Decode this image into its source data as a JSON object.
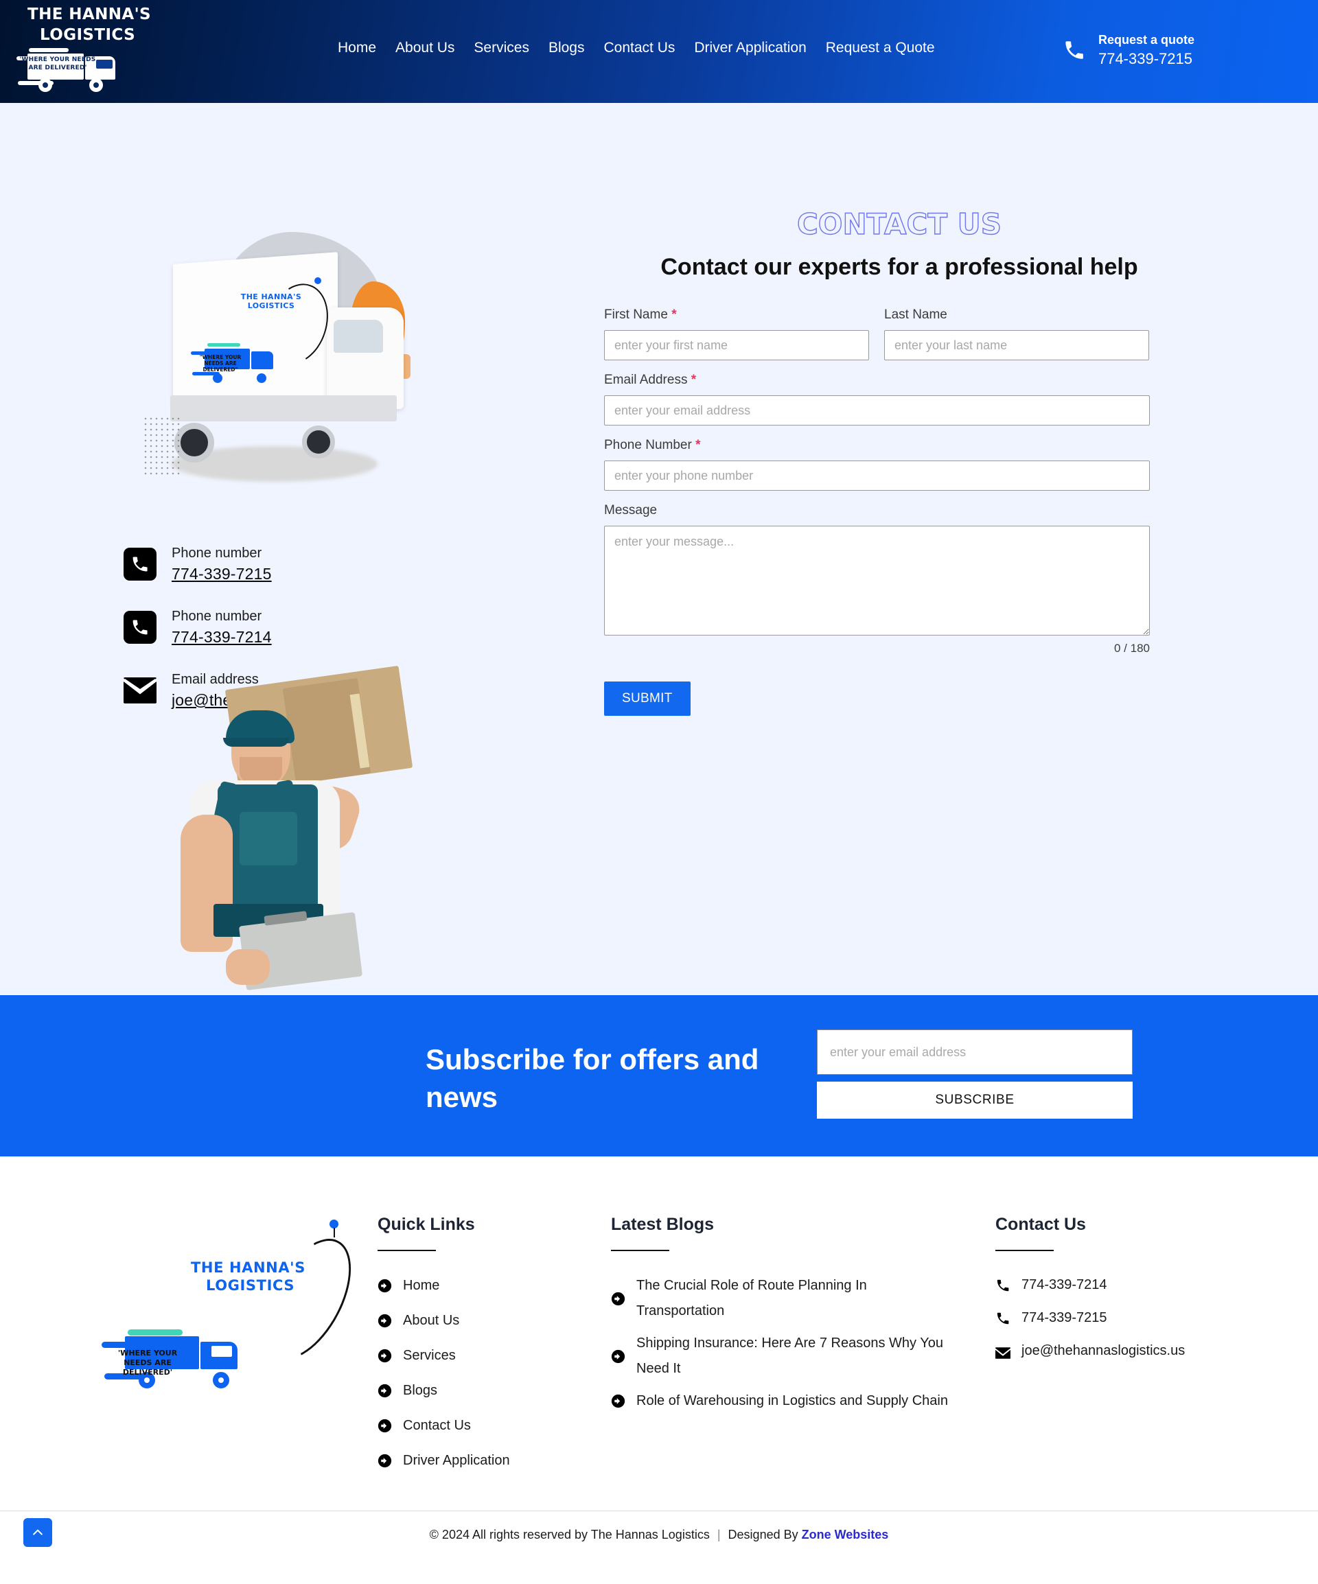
{
  "header": {
    "logo": {
      "line1": "THE HANNA'S",
      "line2": "LOGISTICS",
      "tagline": "'WHERE YOUR NEEDS ARE DELIVERED'"
    },
    "nav": [
      {
        "label": "Home"
      },
      {
        "label": "About Us"
      },
      {
        "label": "Services"
      },
      {
        "label": "Blogs"
      },
      {
        "label": "Contact Us"
      },
      {
        "label": "Driver Application"
      },
      {
        "label": "Request a Quote"
      }
    ],
    "quote": {
      "label": "Request a quote",
      "phone": "774-339-7215"
    }
  },
  "contact": {
    "kicker": "CONTACT US",
    "title": "Contact our experts for a professional help",
    "truck_logo": {
      "line1": "THE HANNA'S",
      "line2": "LOGISTICS",
      "tagline": "\"WHERE YOUR NEEDS ARE DELIVERED\""
    },
    "details": [
      {
        "icon": "phone-icon",
        "label": "Phone number",
        "value": "774-339-7215"
      },
      {
        "icon": "phone-icon",
        "label": "Phone number",
        "value": "774-339-7214"
      },
      {
        "icon": "mail-icon",
        "label": "Email address",
        "value": "joe@thehannaslogistics.us"
      }
    ],
    "form": {
      "first_name": {
        "label": "First Name",
        "required": "*",
        "placeholder": "enter your first name",
        "value": ""
      },
      "last_name": {
        "label": "Last Name",
        "required": "",
        "placeholder": "enter your last name",
        "value": ""
      },
      "email": {
        "label": "Email Address",
        "required": "*",
        "placeholder": "enter your email address",
        "value": ""
      },
      "phone": {
        "label": "Phone Number",
        "required": "*",
        "placeholder": "enter your phone number",
        "value": ""
      },
      "message": {
        "label": "Message",
        "required": "",
        "placeholder": "enter your message...",
        "value": ""
      },
      "counter": "0 / 180",
      "submit_label": "SUBMIT"
    }
  },
  "subscribe": {
    "title": "Subscribe for offers and news",
    "email_placeholder": "enter your email address",
    "email_value": "",
    "button_label": "SUBSCRIBE"
  },
  "footer": {
    "logo": {
      "line1": "THE HANNA'S",
      "line2": "LOGISTICS",
      "tagline": "'WHERE YOUR NEEDS ARE DELIVERED'"
    },
    "quick_links": {
      "heading": "Quick Links",
      "items": [
        {
          "label": "Home"
        },
        {
          "label": "About Us"
        },
        {
          "label": "Services"
        },
        {
          "label": "Blogs"
        },
        {
          "label": "Contact Us"
        },
        {
          "label": "Driver Application"
        }
      ]
    },
    "latest_blogs": {
      "heading": "Latest Blogs",
      "items": [
        {
          "label": "The Crucial Role of Route Planning In Transportation"
        },
        {
          "label": "Shipping Insurance: Here Are 7 Reasons Why You Need It"
        },
        {
          "label": "Role of Warehousing in Logistics and Supply Chain"
        }
      ]
    },
    "contact_us": {
      "heading": "Contact Us",
      "items": [
        {
          "icon": "phone-icon",
          "label": "774-339-7214"
        },
        {
          "icon": "phone-icon",
          "label": "774-339-7215"
        },
        {
          "icon": "mail-icon",
          "label": "joe@thehannaslogistics.us"
        }
      ]
    }
  },
  "bottom": {
    "copyright": "© 2024 All rights reserved by The Hannas Logistics",
    "separator": "|",
    "designed_by": "Designed By",
    "designer": "Zone Websites",
    "scroll_top_icon": "chevron-up-icon"
  },
  "colors": {
    "brand_blue": "#0d64f0",
    "header_dark": "#00122e",
    "page_bg": "#f0f4fe",
    "required_red": "#e8345c",
    "outline_purple": "#6f74ef",
    "link_blue": "#2a2ad1"
  }
}
